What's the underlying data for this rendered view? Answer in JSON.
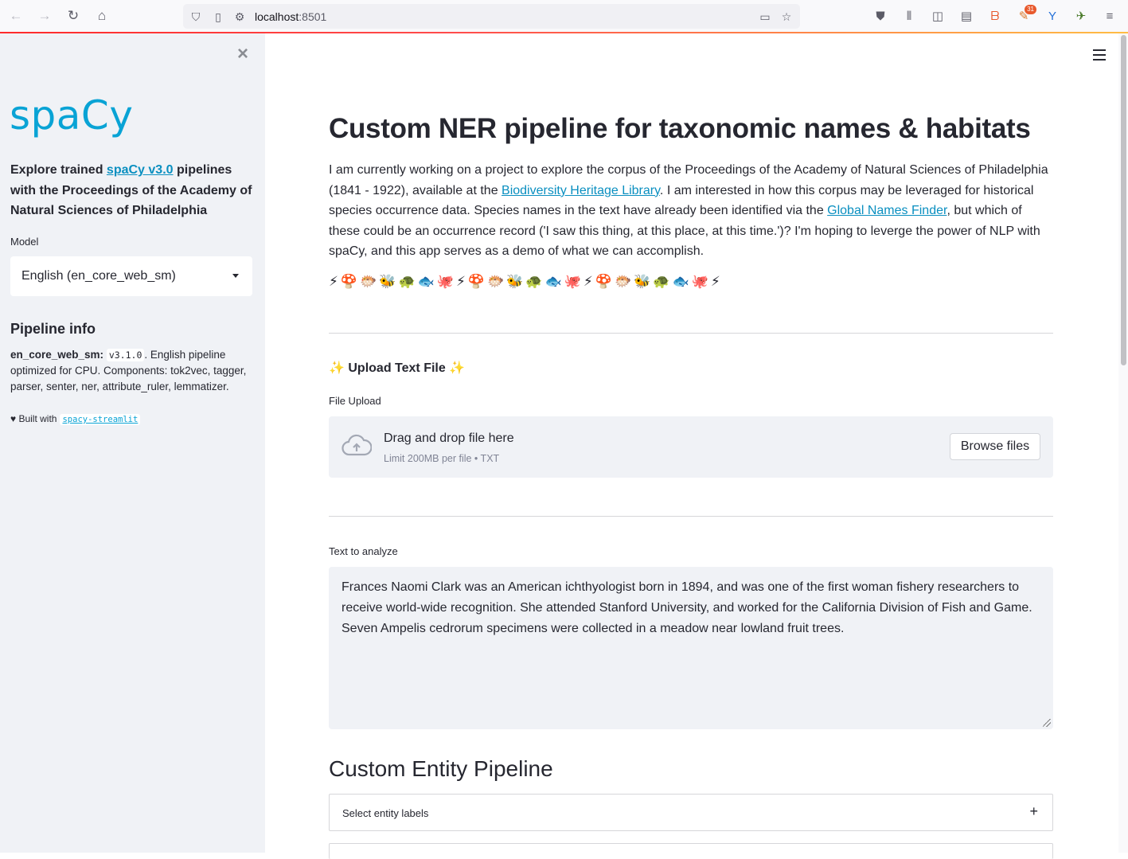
{
  "browser": {
    "url_host": "localhost",
    "url_port": ":8501",
    "addon_badge": "31"
  },
  "sidebar": {
    "logo": "spaCy",
    "desc_pre": "Explore trained ",
    "desc_link": "spaCy v3.0",
    "desc_post": " pipelines with the Proceedings of the Academy of Natural Sciences of Philadelphia",
    "model_label": "Model",
    "model_value": "English (en_core_web_sm)",
    "pipeline_heading": "Pipeline info",
    "pipeline_name": "en_core_web_sm:",
    "pipeline_version": "v3.1.0",
    "pipeline_desc": ". English pipeline optimized for CPU. Components: tok2vec, tagger, parser, senter, ner, attribute_ruler, lemmatizer.",
    "built_with": "♥ Built with",
    "built_link": "spacy-streamlit"
  },
  "main": {
    "title": "Custom NER pipeline for taxonomic names & habitats",
    "intro_1": "I am currently working on a project to explore the corpus of the Proceedings of the Academy of Natural Sciences of Philadelphia (1841 - 1922), available at the ",
    "intro_link1": "Biodiversity Heritage Library",
    "intro_2": ". I am interested in how this corpus may be leveraged for historical species occurrence data. Species names in the text have already been identified via the ",
    "intro_link2": "Global Names Finder",
    "intro_3": ", but which of these could be an occurrence record ('I saw this thing, at this place, at this time.')? I'm hoping to leverge the power of NLP with spaCy, and this app serves as a demo of what we can accomplish.",
    "emojis": "⚡🍄🐡🐝🐢🐟🐙⚡🍄🐡🐝🐢🐟🐙⚡🍄🐡🐝🐢🐟🐙⚡",
    "upload_heading": "✨ Upload Text File ✨",
    "file_upload_label": "File Upload",
    "dropzone_main": "Drag and drop file here",
    "dropzone_sub": "Limit 200MB per file • TXT",
    "browse_button": "Browse files",
    "text_label": "Text to analyze",
    "text_value": "Frances Naomi Clark was an American ichthyologist born in 1894, and was one of the first woman fishery researchers to receive world-wide recognition. She attended Stanford University, and worked for the California Division of Fish and Game. Seven Ampelis cedrorum specimens were collected in a meadow near lowland fruit trees.",
    "section_heading": "Custom Entity Pipeline",
    "entity_select_label": "Select entity labels",
    "expander_icon": "+"
  }
}
